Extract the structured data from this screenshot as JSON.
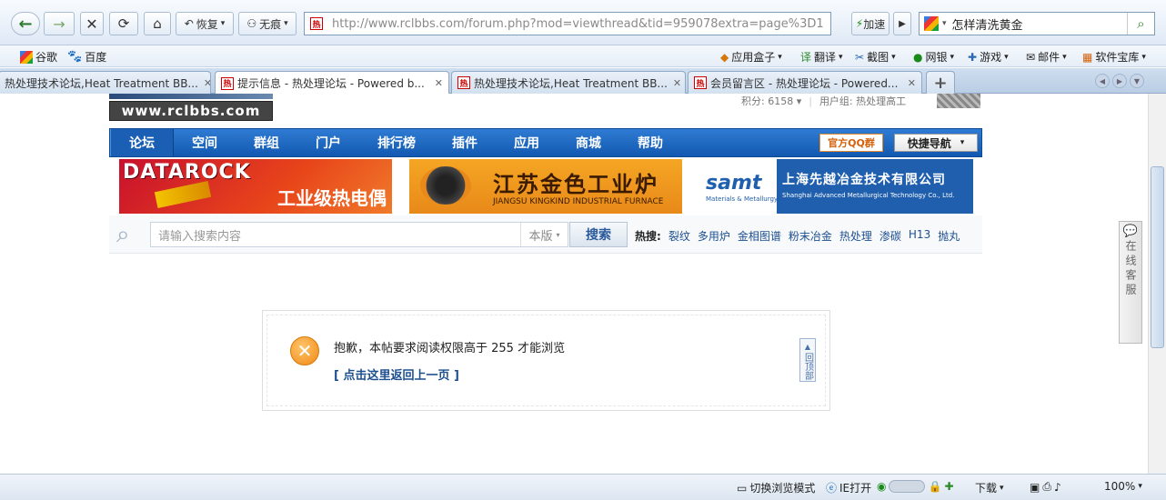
{
  "browser": {
    "back_label": "←",
    "forward_label": "→",
    "restore_label": "恢复",
    "incognito_label": "无痕",
    "url": "http://www.rclbbs.com/forum.php?mod=viewthread&tid=959078extra=page%3D1",
    "speedup_label": "加速",
    "search_query": "怎样清洗黄金"
  },
  "bookmarks": {
    "left": [
      "谷歌",
      "百度"
    ],
    "right": [
      "应用盒子",
      "翻译",
      "截图",
      "网银",
      "游戏",
      "邮件",
      "软件宝库"
    ]
  },
  "tabs": [
    {
      "title": "热处理技术论坛,Heat Treatment BB..."
    },
    {
      "title": "提示信息 - 热处理论坛 - Powered b..."
    },
    {
      "title": "热处理技术论坛,Heat Treatment BB..."
    },
    {
      "title": "会员留言区 - 热处理论坛 - Powered..."
    }
  ],
  "site": {
    "logo_text": "www.rclbbs.com",
    "points_label": "积分: 6158 ▾",
    "group_label": "用户组: 热处理高工",
    "nav": [
      "论坛",
      "空间",
      "群组",
      "门户",
      "排行榜",
      "插件",
      "应用",
      "商城",
      "帮助"
    ],
    "qq_group": "官方QQ群",
    "quick_nav": "快捷导航"
  },
  "banners": {
    "b1_brand": "DATAROCK",
    "b1_text": "工业级热电偶",
    "b2_title": "江苏金色工业炉",
    "b2_sub": "JIANGSU KINGKIND INDUSTRIAL FURNACE",
    "b3_brand": "samt",
    "b3_brand_sub": "Materials & Metallurgy",
    "b3_title": "上海先越冶金技术有限公司",
    "b3_sub": "Shanghai Advanced Metallurgical Technology Co., Ltd."
  },
  "search": {
    "placeholder": "请输入搜索内容",
    "scope": "本版",
    "button": "搜索",
    "hot_label": "热搜:",
    "hot": [
      "裂纹",
      "多用炉",
      "金相图谱",
      "粉末冶金",
      "热处理",
      "渗碳",
      "H13",
      "抛丸"
    ]
  },
  "message": {
    "text": "抱歉，本帖要求阅读权限高于 255 才能浏览",
    "back_link": "[ 点击这里返回上一页 ]",
    "back_top": "回顶部"
  },
  "side_service": "在线客服",
  "status": {
    "mode": "切换浏览模式",
    "ie": "IE打开",
    "download": "下载",
    "zoom": "100%"
  }
}
